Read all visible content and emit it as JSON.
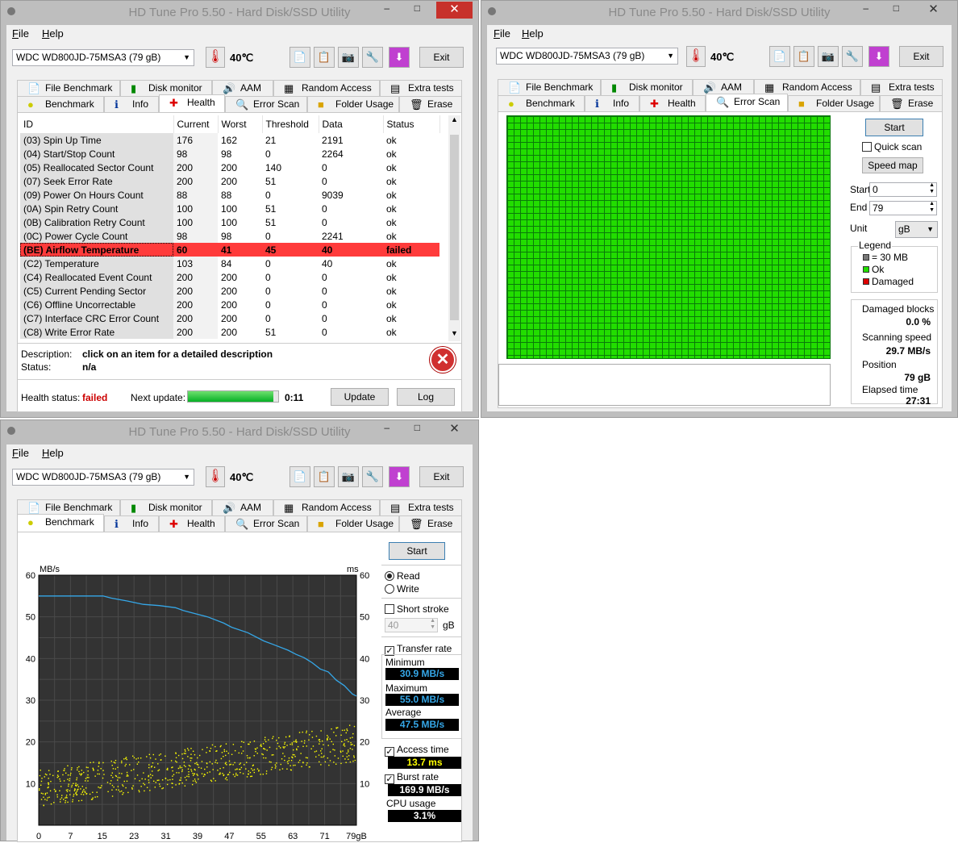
{
  "app_title": "HD Tune Pro 5.50 - Hard Disk/SSD Utility",
  "window_controls": {
    "minimize": "–",
    "maximize": "□",
    "close": "✕"
  },
  "menu": {
    "file": "File",
    "help": "Help"
  },
  "drive": "WDC WD800JD-75MSA3 (79 gB)",
  "temperature": "40℃",
  "exit_label": "Exit",
  "tabs_top": [
    "File Benchmark",
    "Disk monitor",
    "AAM",
    "Random Access",
    "Extra tests"
  ],
  "tabs_bottom": [
    "Benchmark",
    "Info",
    "Health",
    "Error Scan",
    "Folder Usage",
    "Erase"
  ],
  "health": {
    "columns": [
      "ID",
      "Current",
      "Worst",
      "Threshold",
      "Data",
      "Status"
    ],
    "rows": [
      [
        "(03) Spin Up Time",
        "176",
        "162",
        "21",
        "2191",
        "ok"
      ],
      [
        "(04) Start/Stop Count",
        "98",
        "98",
        "0",
        "2264",
        "ok"
      ],
      [
        "(05) Reallocated Sector Count",
        "200",
        "200",
        "140",
        "0",
        "ok"
      ],
      [
        "(07) Seek Error Rate",
        "200",
        "200",
        "51",
        "0",
        "ok"
      ],
      [
        "(09) Power On Hours Count",
        "88",
        "88",
        "0",
        "9039",
        "ok"
      ],
      [
        "(0A) Spin Retry Count",
        "100",
        "100",
        "51",
        "0",
        "ok"
      ],
      [
        "(0B) Calibration Retry Count",
        "100",
        "100",
        "51",
        "0",
        "ok"
      ],
      [
        "(0C) Power Cycle Count",
        "98",
        "98",
        "0",
        "2241",
        "ok"
      ],
      [
        "(BE) Airflow Temperature",
        "60",
        "41",
        "45",
        "40",
        "failed"
      ],
      [
        "(C2) Temperature",
        "103",
        "84",
        "0",
        "40",
        "ok"
      ],
      [
        "(C4) Reallocated Event Count",
        "200",
        "200",
        "0",
        "0",
        "ok"
      ],
      [
        "(C5) Current Pending Sector",
        "200",
        "200",
        "0",
        "0",
        "ok"
      ],
      [
        "(C6) Offline Uncorrectable",
        "200",
        "200",
        "0",
        "0",
        "ok"
      ],
      [
        "(C7) Interface CRC Error Count",
        "200",
        "200",
        "0",
        "0",
        "ok"
      ],
      [
        "(C8) Write Error Rate",
        "200",
        "200",
        "51",
        "0",
        "ok"
      ]
    ],
    "failed_row_index": 8,
    "description_label": "Description:",
    "description_value": "click on an item for a detailed description",
    "status_label": "Status:",
    "status_value": "n/a",
    "health_status_label": "Health status:",
    "health_status_value": "failed",
    "next_update_label": "Next update:",
    "next_update_progress": 0.95,
    "next_update_time": "0:11",
    "update_button": "Update",
    "log_button": "Log"
  },
  "error_scan": {
    "start_button": "Start",
    "quick_scan_label": "Quick scan",
    "speed_map_button": "Speed map",
    "start_label": "Start",
    "start_value": "0",
    "end_label": "End",
    "end_value": "79",
    "unit_label": "Unit",
    "unit_value": "gB",
    "legend_title": "Legend",
    "legend_block": "= 30 MB",
    "legend_ok": "Ok",
    "legend_damaged": "Damaged",
    "damaged_blocks_label": "Damaged blocks",
    "damaged_blocks_value": "0.0 %",
    "scanning_speed_label": "Scanning speed",
    "scanning_speed_value": "29.7 MB/s",
    "position_label": "Position",
    "position_value": "79 gB",
    "elapsed_label": "Elapsed time",
    "elapsed_value": "27:31",
    "colors": {
      "ok": "#22dd00",
      "damaged": "#dd0000",
      "block": "#777777"
    }
  },
  "benchmark": {
    "start_button": "Start",
    "read_label": "Read",
    "write_label": "Write",
    "short_stroke_label": "Short stroke",
    "short_stroke_value": "40",
    "short_stroke_unit": "gB",
    "transfer_rate_label": "Transfer rate",
    "minimum_label": "Minimum",
    "minimum_value": "30.9 MB/s",
    "maximum_label": "Maximum",
    "maximum_value": "55.0 MB/s",
    "average_label": "Average",
    "average_value": "47.5 MB/s",
    "access_time_label": "Access time",
    "access_time_value": "13.7 ms",
    "burst_rate_label": "Burst rate",
    "burst_rate_value": "169.9 MB/s",
    "cpu_usage_label": "CPU usage",
    "cpu_usage_value": "3.1%"
  },
  "chart_data": {
    "type": "line",
    "y_left_label": "MB/s",
    "y_right_label": "ms",
    "ylim": [
      0,
      60
    ],
    "y_ticks": [
      10,
      20,
      30,
      40,
      50,
      60
    ],
    "x_ticks": [
      "0",
      "7",
      "15",
      "23",
      "31",
      "39",
      "47",
      "55",
      "63",
      "71",
      "79gB"
    ],
    "xlim": [
      0,
      79
    ],
    "series": [
      {
        "color": "#35a7e8",
        "x": [
          0,
          8,
          16,
          18,
          22,
          26,
          30,
          34,
          36,
          40,
          42,
          46,
          48,
          52,
          56,
          58,
          62,
          64,
          66,
          68,
          70,
          72,
          74,
          76,
          78,
          79
        ],
        "y": [
          55,
          55,
          55,
          54.5,
          53.8,
          53,
          52.7,
          52.2,
          51.5,
          50.5,
          50,
          48.5,
          47.5,
          46.2,
          44.2,
          43.5,
          42,
          41,
          40.2,
          39,
          37.5,
          36.8,
          34.8,
          33.5,
          31.5,
          31
        ]
      },
      {
        "color": "#ffff00",
        "kind": "scatter",
        "x": [
          0,
          79
        ],
        "y": [
          9,
          20
        ]
      }
    ]
  }
}
